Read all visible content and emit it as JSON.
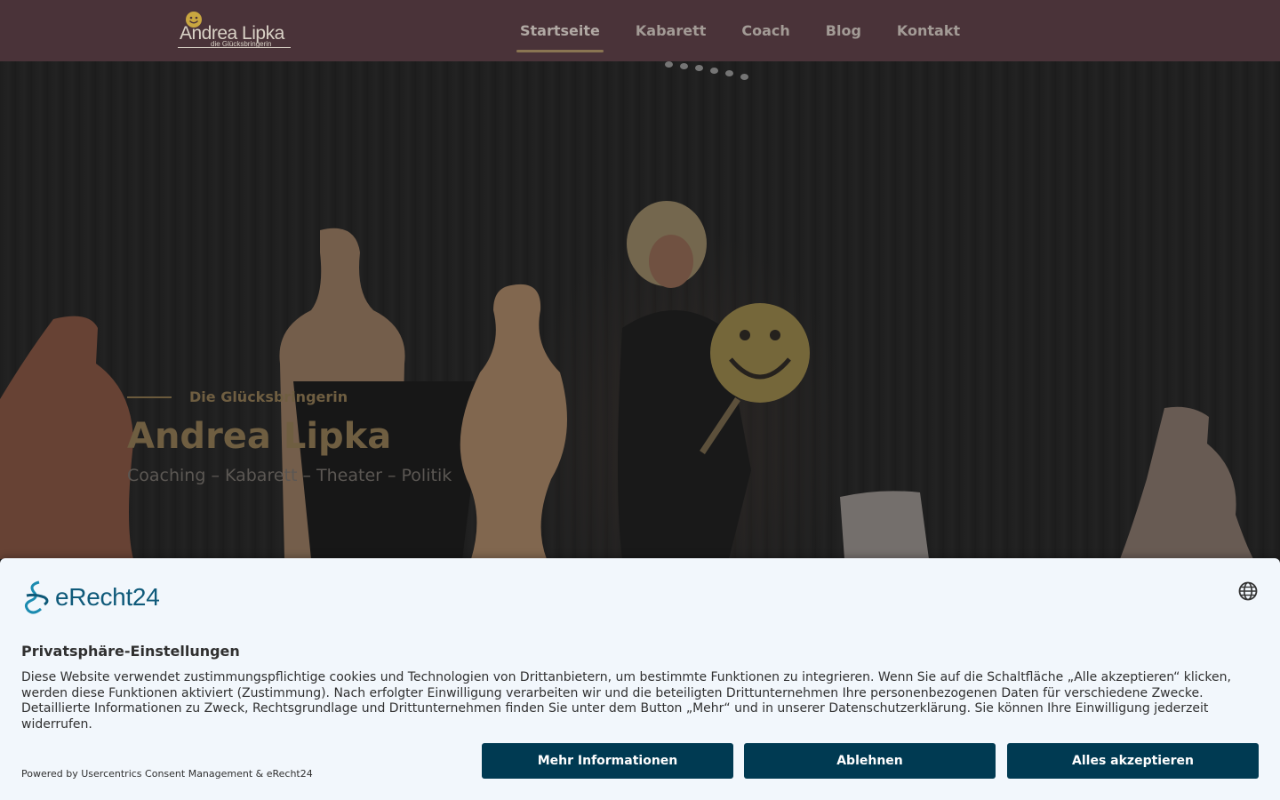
{
  "header": {
    "logo": {
      "name": "Andrea Lipka",
      "tagline": "die Glücksbringerin",
      "icon": "smiley-icon"
    },
    "nav": [
      {
        "label": "Startseite",
        "active": true
      },
      {
        "label": "Kabarett",
        "active": false
      },
      {
        "label": "Coach",
        "active": false
      },
      {
        "label": "Blog",
        "active": false
      },
      {
        "label": "Kontakt",
        "active": false
      }
    ]
  },
  "hero": {
    "eyebrow": "Die Glücksbringerin",
    "title": "Andrea Lipka",
    "subtitle": "Coaching – Kabarett – Theater – Politik"
  },
  "consent": {
    "brand": "eRecht24",
    "brand_icon": "erecht24-logo-icon",
    "language_icon": "globe-icon",
    "title": "Privatsphäre-Einstellungen",
    "body": "Diese Website verwendet zustimmungspflichtige cookies und Technologien von Drittanbietern, um bestimmte Funktionen zu integrieren. Wenn Sie auf die Schaltfläche „Alle akzeptieren“ klicken, werden diese Funktionen aktiviert (Zustimmung). Nach erfolgter Einwilligung verarbeiten wir und die beteiligten Drittunternehmen Ihre personenbezogenen Daten für verschiedene Zwecke. Detaillierte Informationen zu Zweck, Rechtsgrundlage und Drittunternehmen finden Sie unter dem Button „Mehr“ und in unserer Datenschutzerklärung. Sie können Ihre Einwilligung jederzeit widerrufen.",
    "powered_by": "Powered by Usercentrics Consent Management & eRecht24",
    "buttons": {
      "more": "Mehr Informationen",
      "deny": "Ablehnen",
      "accept": "Alles akzeptieren"
    }
  },
  "colors": {
    "header_bg": "#4a3339",
    "accent_gold": "#8a7552",
    "consent_bg": "#f2f7fc",
    "button_bg": "#003a52",
    "brand_teal": "#0f5a7a"
  }
}
